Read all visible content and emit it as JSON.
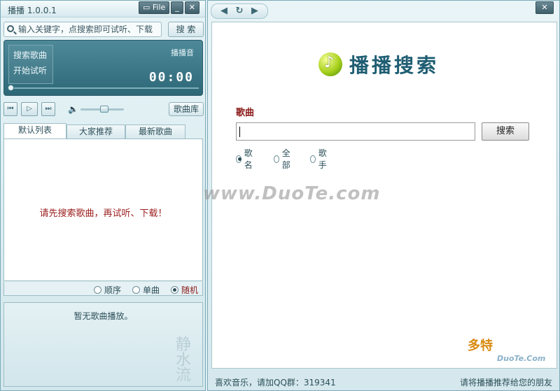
{
  "player": {
    "title": "播播 1.0.0.1",
    "file_label": "File",
    "min_label": "_",
    "close_label": "✕",
    "search_placeholder": "输入关键字，点搜索即可试听、下载",
    "search_button": "搜 索",
    "display": {
      "menu": [
        "搜索歌曲",
        "开始试听"
      ],
      "label": "播播音",
      "time": "00:00"
    },
    "progress": 0,
    "volume": 0.55,
    "library_button": "歌曲库",
    "tabs": [
      "默认列表",
      "大家推荐",
      "最新歌曲"
    ],
    "empty_message": "请先搜索歌曲，再试听、下载！",
    "play_modes": [
      {
        "label": "顺序",
        "selected": false
      },
      {
        "label": "单曲",
        "selected": false
      },
      {
        "label": "随机",
        "selected": true
      }
    ],
    "now_playing": "暂无歌曲播放。"
  },
  "browser": {
    "close_label": "✕",
    "logo_text": "播播搜索",
    "song_label": "歌曲",
    "search_button": "搜索",
    "search_value": "",
    "options": [
      {
        "label": "歌名",
        "selected": true
      },
      {
        "label": "全部",
        "selected": false
      },
      {
        "label": "歌手",
        "selected": false
      }
    ],
    "status_left": "喜欢音乐，请加QQ群：319341",
    "status_right": "请将播播推荐给您的朋友"
  },
  "watermarks": {
    "center": "www.DuoTe.com",
    "corner": "多特",
    "corner_sub": "DuoTe.Com"
  }
}
